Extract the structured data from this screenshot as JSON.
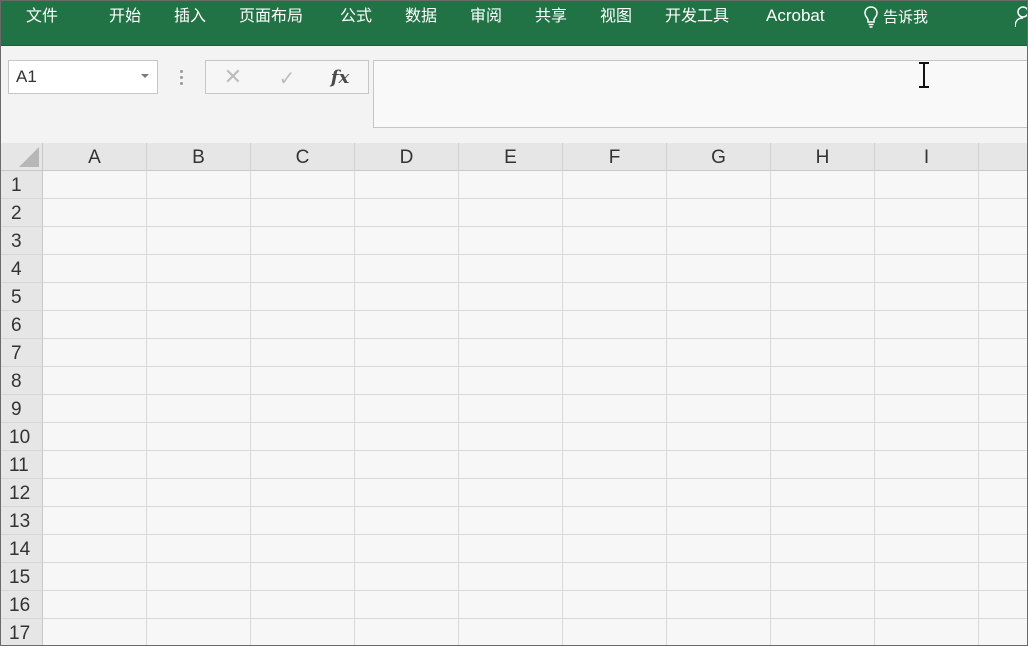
{
  "ribbon": {
    "tabs": [
      {
        "label": "文件"
      },
      {
        "label": "开始"
      },
      {
        "label": "插入"
      },
      {
        "label": "页面布局"
      },
      {
        "label": "公式"
      },
      {
        "label": "数据"
      },
      {
        "label": "审阅"
      },
      {
        "label": "共享"
      },
      {
        "label": "视图"
      },
      {
        "label": "开发工具"
      },
      {
        "label": "Acrobat"
      }
    ],
    "tell_me": {
      "icon": "lightbulb-icon",
      "label": "告诉我"
    },
    "account_icon": "person-icon",
    "background_color": "#217346"
  },
  "formula_bar": {
    "name_box": {
      "value": "A1",
      "dropdown_icon": "chevron-down-icon"
    },
    "cancel_symbol": "✕",
    "enter_symbol": "✓",
    "insert_function_label": "fx",
    "formula_value": ""
  },
  "sheet": {
    "columns": [
      "A",
      "B",
      "C",
      "D",
      "E",
      "F",
      "G",
      "H",
      "I"
    ],
    "rows": [
      "1",
      "2",
      "3",
      "4",
      "5",
      "6",
      "7",
      "8",
      "9",
      "10",
      "11",
      "12",
      "13",
      "14",
      "15",
      "16",
      "17"
    ]
  }
}
